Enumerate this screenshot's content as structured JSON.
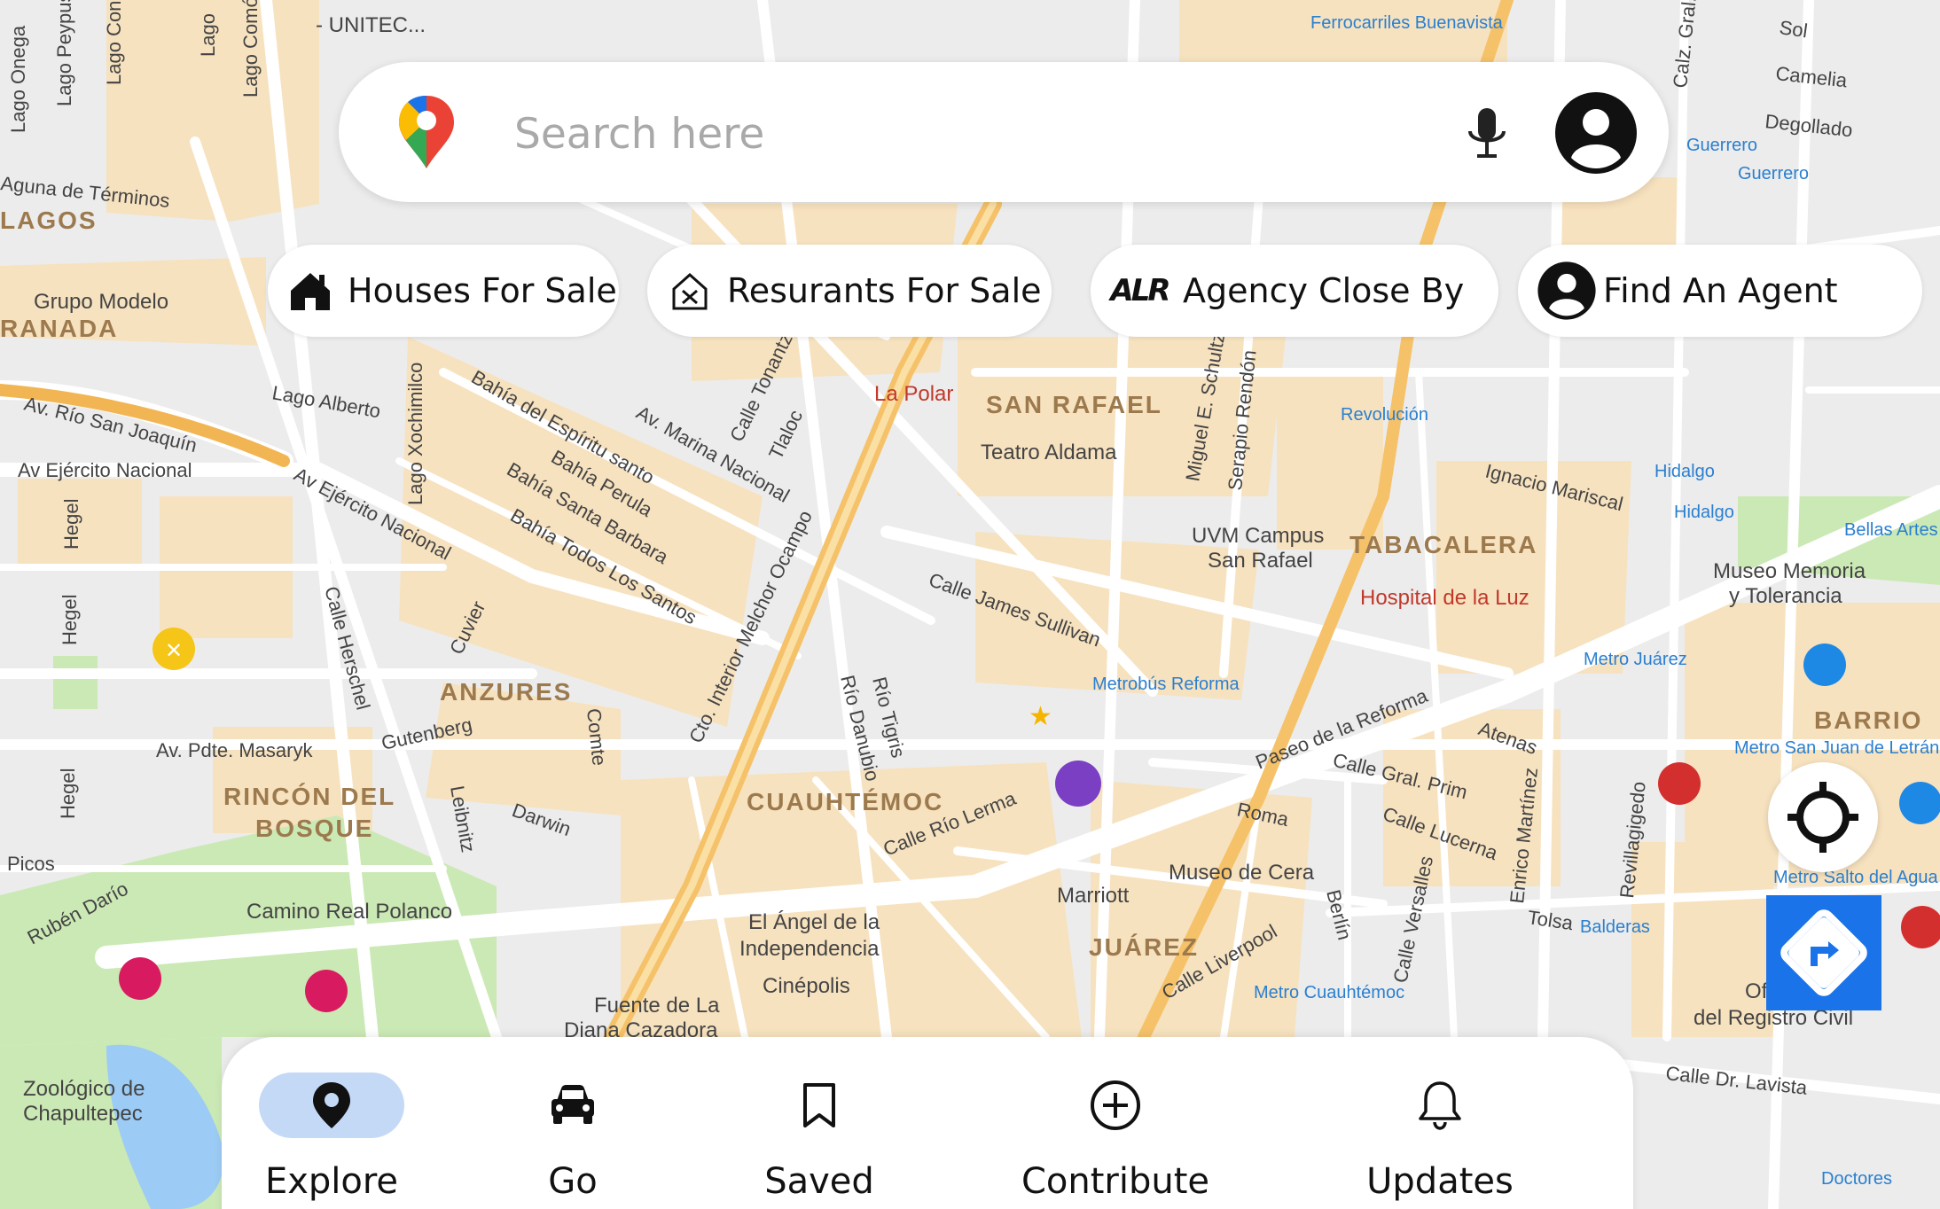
{
  "search": {
    "placeholder": "Search here"
  },
  "chips": [
    {
      "label": "Houses For Sale",
      "icon": "house-icon"
    },
    {
      "label": "Resurants For Sale",
      "icon": "restaurant-icon"
    },
    {
      "label": "Agency Close By",
      "icon": "alr-logo-icon",
      "icon_text": "ALR"
    },
    {
      "label": "Find An Agent",
      "icon": "person-icon"
    }
  ],
  "bottom_nav": [
    {
      "label": "Explore",
      "icon": "location-pin-icon",
      "active": true
    },
    {
      "label": "Go",
      "icon": "car-icon",
      "active": false
    },
    {
      "label": "Saved",
      "icon": "bookmark-icon",
      "active": false
    },
    {
      "label": "Contribute",
      "icon": "plus-circle-icon",
      "active": false
    },
    {
      "label": "Updates",
      "icon": "bell-icon",
      "active": false
    }
  ],
  "map": {
    "districts": [
      "SAN RAFAEL",
      "TABACALERA",
      "ANZURES",
      "RINCÓN DEL",
      "BOSQUE",
      "CUAUHTÉMOC",
      "JUÁREZ",
      "BARRIO",
      "RANADA",
      "LAGOS"
    ],
    "streets": [
      "Av. Río San Joaquín",
      "Av Ejército Nacional",
      "Av Ejército Nacional",
      "Cto. Interior Melchor Ocampo",
      "Calle James Sullivan",
      "Paseo de la Reforma",
      "Calle Río Lerma",
      "Av. Pdte. Masaryk",
      "Bahía del Espíritu santo",
      "Bahía Perula",
      "Bahía Santa Barbara",
      "Bahía Todos Los Santos",
      "Av. Marina Nacional",
      "Calle Tonantzin",
      "Tlaloc",
      "Lago Alberto",
      "Lago Xochimilco",
      "Calle Herschel",
      "Gutenberg",
      "Darwin",
      "Leibnitz",
      "Cuvier",
      "Comte",
      "Río Danubio",
      "Río Tigris",
      "Roma",
      "Calle Gral. Prim",
      "Calle Lucerna",
      "Atenas",
      "Calle Versalles",
      "Berlín",
      "Calle Liverpool",
      "Tolsa",
      "Enrico Martínez",
      "Revillagigedo",
      "Calle Dr. Lavista",
      "Ignacio Mariscal",
      "Miguel E. Schultz",
      "Serapio Rendón",
      "Hegel",
      "Hegel",
      "Hegel",
      "Rubén Darío",
      "Picos",
      "Calz. Gral.",
      "Aguna de Términos",
      "Lago Onega",
      "Lago Peypus",
      "Lago Con",
      "Lago Comó",
      "Lago",
      "Camelia",
      "Degollado",
      "Sol"
    ],
    "places": [
      "La Polar",
      "Teatro Aldama",
      "UVM Campus",
      "San Rafael",
      "Hospital de la Luz",
      "Museo Memoria",
      "y Tolerancia",
      "Museo de Cera",
      "Marriott",
      "El Ángel de la",
      "Independencia",
      "Cinépolis",
      "Fuente de La",
      "Diana Cazadora",
      "Camino Real Polanco",
      "Grupo Modelo",
      "Zoológico de",
      "Chapultepec",
      "Oficina",
      "del Registro Civil",
      "Bellas Artes",
      "- UNITEC...",
      "Ferrocarriles Buenavista"
    ],
    "metro": [
      "Revolución",
      "Hidalgo",
      "Hidalgo",
      "Guerrero",
      "Guerrero",
      "Metro Juárez",
      "Metrobús Reforma",
      "Metro San Juan de Letrán",
      "Metro Salto del Agua",
      "Balderas",
      "Metro Cuauhtémoc",
      "Doctores"
    ],
    "colors": {
      "background": "#ececec",
      "block": "#f8f8f6",
      "built": "#f7e2bf",
      "park": "#cbe9b5",
      "water": "#9ccbf5",
      "highway": "#f5c26a",
      "metro": "#2a7fd0"
    }
  },
  "controls": {
    "mic_icon": "microphone-icon",
    "account_icon": "account-icon",
    "my_location_icon": "crosshair-icon",
    "directions_icon": "directions-icon"
  }
}
